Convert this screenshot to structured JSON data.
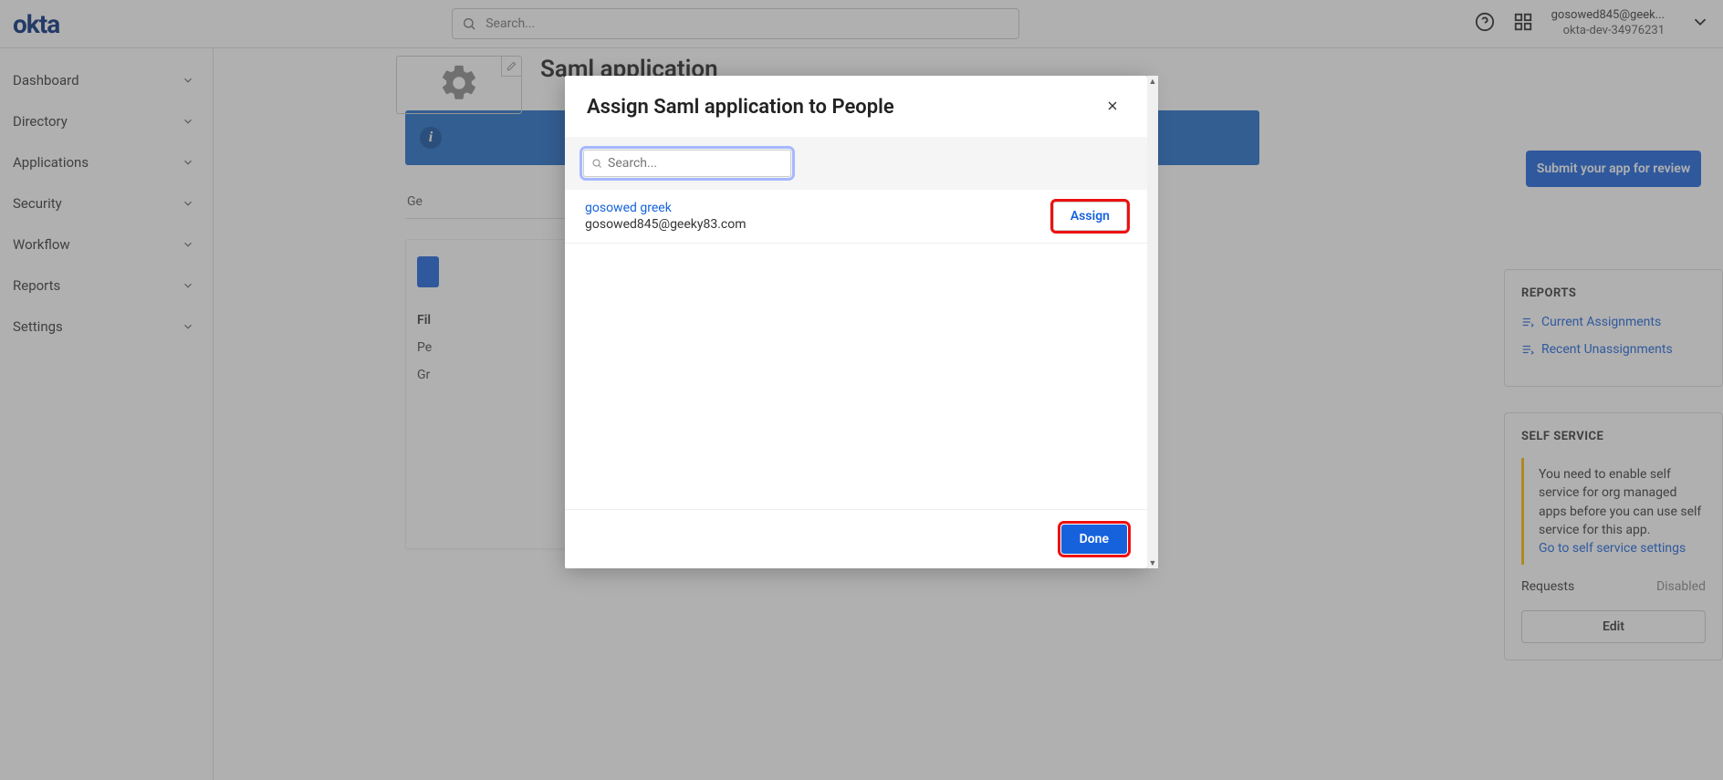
{
  "header": {
    "search_placeholder": "Search...",
    "user_email": "gosowed845@geek...",
    "user_org": "okta-dev-34976231"
  },
  "sidebar": {
    "items": [
      "Dashboard",
      "Directory",
      "Applications",
      "Security",
      "Workflow",
      "Reports",
      "Settings"
    ]
  },
  "app": {
    "title": "Saml application",
    "submit_label": "Submit your app for review",
    "tabs": {
      "general": "Ge"
    },
    "filters_heading": "Fil",
    "people_label": "Pe",
    "groups_label": "Gr"
  },
  "reports_card": {
    "title": "REPORTS",
    "link1": "Current Assignments",
    "link2": "Recent Unassignments"
  },
  "selfservice_card": {
    "title": "SELF SERVICE",
    "message": "You need to enable self service for org managed apps before you can use self service for this app.",
    "link": "Go to self service settings",
    "requests_label": "Requests",
    "requests_value": "Disabled",
    "edit_label": "Edit"
  },
  "modal": {
    "title": "Assign Saml application to People",
    "search_placeholder": "Search...",
    "people": [
      {
        "name": "gosowed greek",
        "email": "gosowed845@geeky83.com"
      }
    ],
    "assign_label": "Assign",
    "done_label": "Done"
  }
}
